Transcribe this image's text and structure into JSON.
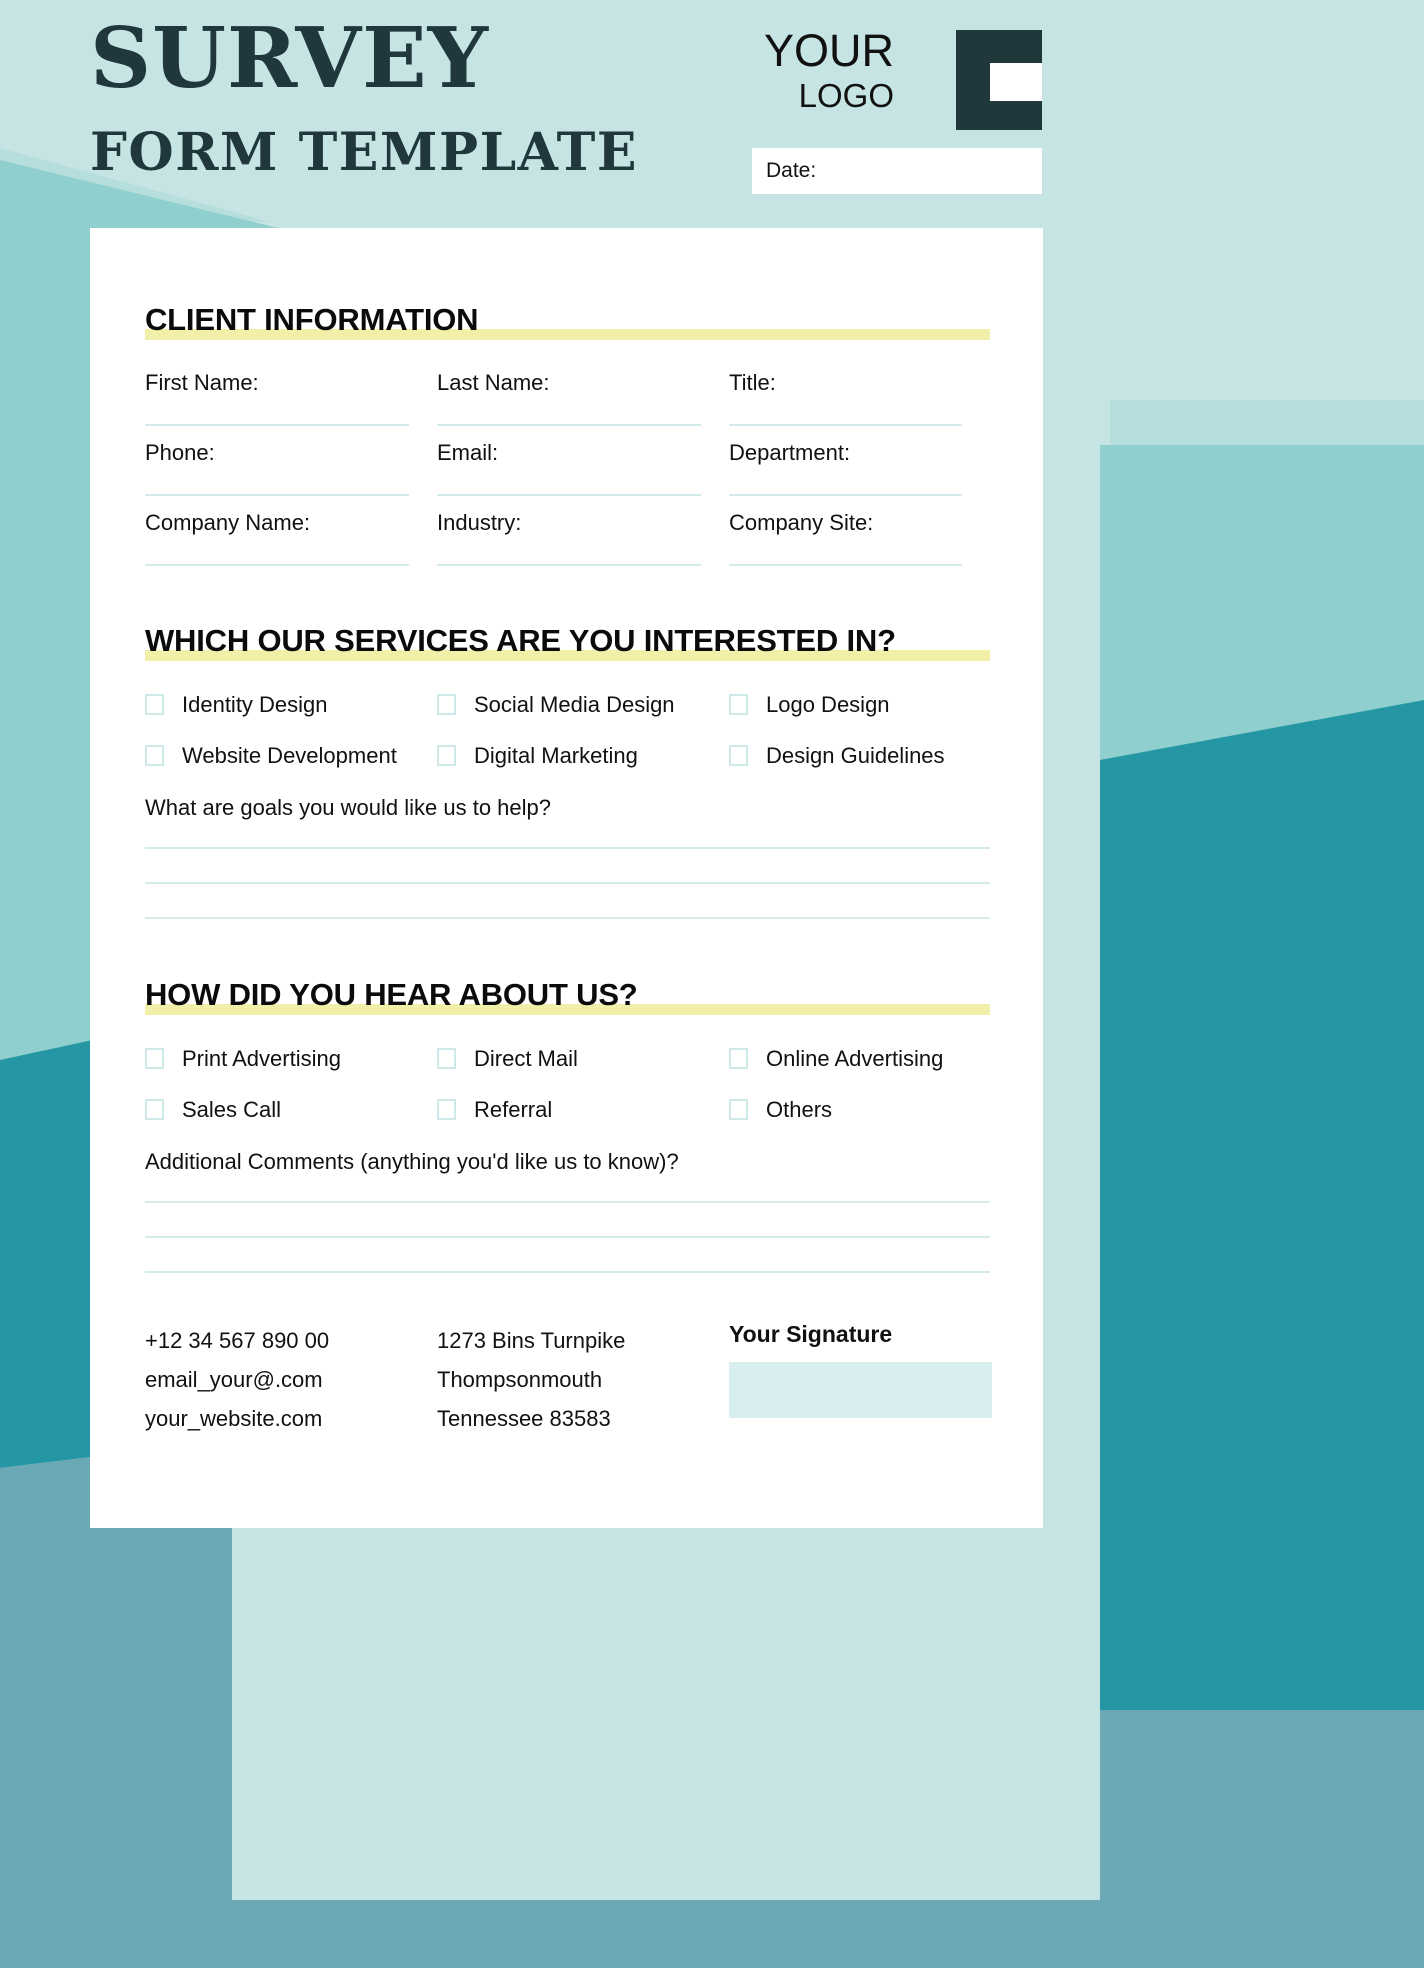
{
  "theme": {
    "bg_light": "#c5e4e3",
    "bg_mid": "#8fcfcd",
    "bg_teal": "#2596a4",
    "bg_steel": "#6aa8b5",
    "ink": "#20383c",
    "highlight_yellow": "#f2efa8",
    "line_cyan": "#d5eaea",
    "sig_fill": "#d7edee"
  },
  "header": {
    "title_main": "SURVEY",
    "title_sub": "FORM TEMPLATE",
    "logo": {
      "line1": "YOUR",
      "line2": "LOGO",
      "mark_icon": "bracket-square-logo-icon"
    },
    "date_field": {
      "label": "Date:",
      "value": "",
      "placeholder": ""
    }
  },
  "sections": {
    "client_information": {
      "heading": "CLIENT INFORMATION",
      "fields": [
        {
          "label": "First Name:",
          "value": ""
        },
        {
          "label": "Last Name:",
          "value": ""
        },
        {
          "label": "Title:",
          "value": ""
        },
        {
          "label": "Phone:",
          "value": ""
        },
        {
          "label": "Email:",
          "value": ""
        },
        {
          "label": "Department:",
          "value": ""
        },
        {
          "label": "Company Name:",
          "value": ""
        },
        {
          "label": "Industry:",
          "value": ""
        },
        {
          "label": "Company Site:",
          "value": ""
        }
      ]
    },
    "services": {
      "heading": "WHICH OUR SERVICES ARE YOU INTERESTED IN?",
      "options": [
        {
          "label": "Identity Design",
          "checked": false
        },
        {
          "label": "Social Media Design",
          "checked": false
        },
        {
          "label": "Logo Design",
          "checked": false
        },
        {
          "label": "Website Development",
          "checked": false
        },
        {
          "label": "Digital Marketing",
          "checked": false
        },
        {
          "label": "Design Guidelines",
          "checked": false
        }
      ],
      "question": "What are goals you would like us to help?",
      "answer_lines": 3
    },
    "hear_about_us": {
      "heading": "HOW DID YOU HEAR ABOUT US?",
      "options": [
        {
          "label": "Print Advertising",
          "checked": false
        },
        {
          "label": "Direct Mail",
          "checked": false
        },
        {
          "label": "Online Advertising",
          "checked": false
        },
        {
          "label": "Sales Call",
          "checked": false
        },
        {
          "label": "Referral",
          "checked": false
        },
        {
          "label": "Others",
          "checked": false
        }
      ],
      "question": "Additional Comments (anything you'd like us to know)?",
      "answer_lines": 3
    }
  },
  "footer": {
    "contact": {
      "phone": "+12 34 567 890 00",
      "email": "email_your@.com",
      "website": "your_website.com"
    },
    "address": {
      "line1": "1273 Bins Turnpike",
      "line2": "Thompsonmouth",
      "line3": "Tennessee 83583"
    },
    "signature": {
      "title": "Your Signature",
      "value": ""
    }
  }
}
